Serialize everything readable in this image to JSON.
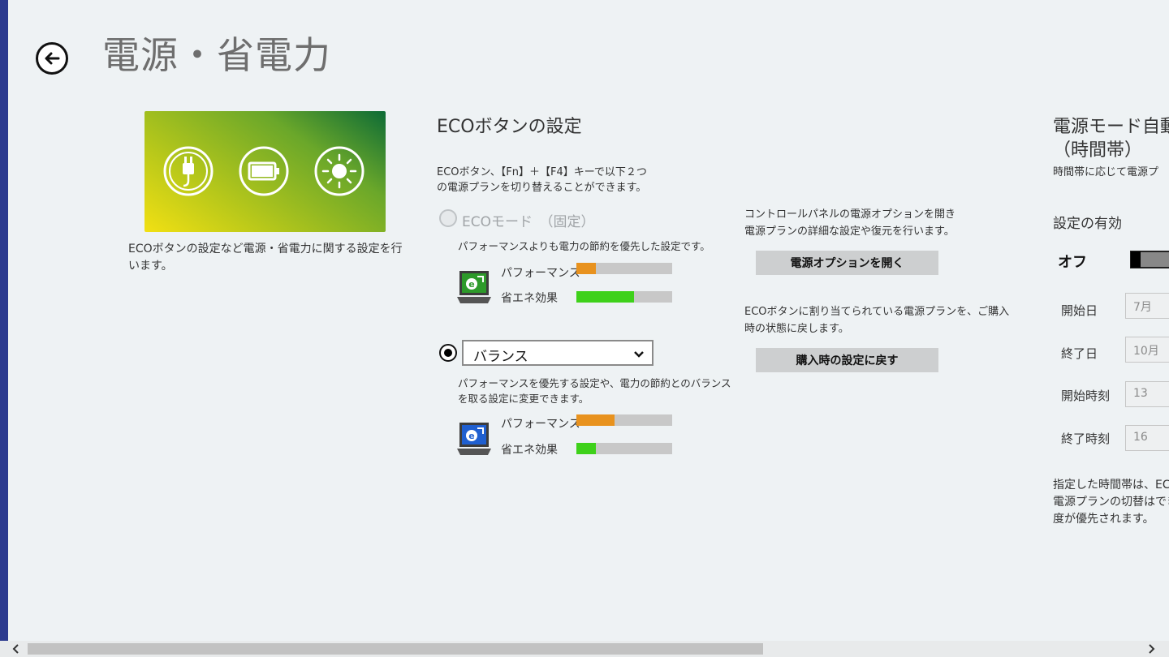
{
  "page": {
    "title": "電源・省電力",
    "back_icon": "back-arrow-icon"
  },
  "hero": {
    "icons": [
      "plug-icon",
      "battery-icon",
      "brightness-icon"
    ],
    "description": "ECOボタンの設定など電源・省電力に関する設定を行います。"
  },
  "eco": {
    "title": "ECOボタンの設定",
    "intro_line1": "ECOボタン、【Fn】＋【F4】キーで以下２つ",
    "intro_line2": "の電源プランを切り替えることができます。",
    "mode1": {
      "label": "ECOモード　（固定）",
      "selected": false,
      "enabled": false,
      "desc": "パフォーマンスよりも電力の節約を優先した設定です。",
      "performance_label": "パフォーマンス",
      "performance_level": 0.2,
      "saving_label": "省エネ効果",
      "saving_level": 0.6
    },
    "mode2": {
      "selected": true,
      "select_value": "バランス",
      "desc_line1": "パフォーマンスを優先する設定や、電力の節約とのバランス",
      "desc_line2": "を取る設定に変更できます。",
      "performance_label": "パフォーマンス",
      "performance_level": 0.4,
      "saving_label": "省エネ効果",
      "saving_level": 0.2
    },
    "colors": {
      "performance": "#e8921e",
      "saving": "#3ed11a",
      "bar_bg": "#c8c8c8"
    }
  },
  "power_options": {
    "desc_line1": "コントロールパネルの電源オプションを開き",
    "desc_line2": "電源プランの詳細な設定や復元を行います。",
    "button": "電源オプションを開く"
  },
  "reset": {
    "desc_line1": "ECOボタンに割り当てられている電源プランを、ご購入",
    "desc_line2": "時の状態に戻します。",
    "button": "購入時の設定に戻す"
  },
  "auto_mode": {
    "title_line1": "電源モード自動",
    "title_line2": "（時間帯）",
    "subtitle": "時間帯に応じて電源プ",
    "enabled_label": "設定の有効",
    "toggle_state": "オフ",
    "fields": [
      {
        "label": "開始日",
        "value": "7月"
      },
      {
        "label": "終了日",
        "value": "10月"
      },
      {
        "label": "開始時刻",
        "value": "13"
      },
      {
        "label": "終了時刻",
        "value": "16"
      }
    ],
    "note_line1": "指定した時間帯は、EC",
    "note_line2": "電源プランの切替はでき",
    "note_line3": "度が優先されます。"
  },
  "scrollbar": {
    "left_icon": "scroll-left-icon",
    "right_icon": "scroll-right-icon"
  }
}
